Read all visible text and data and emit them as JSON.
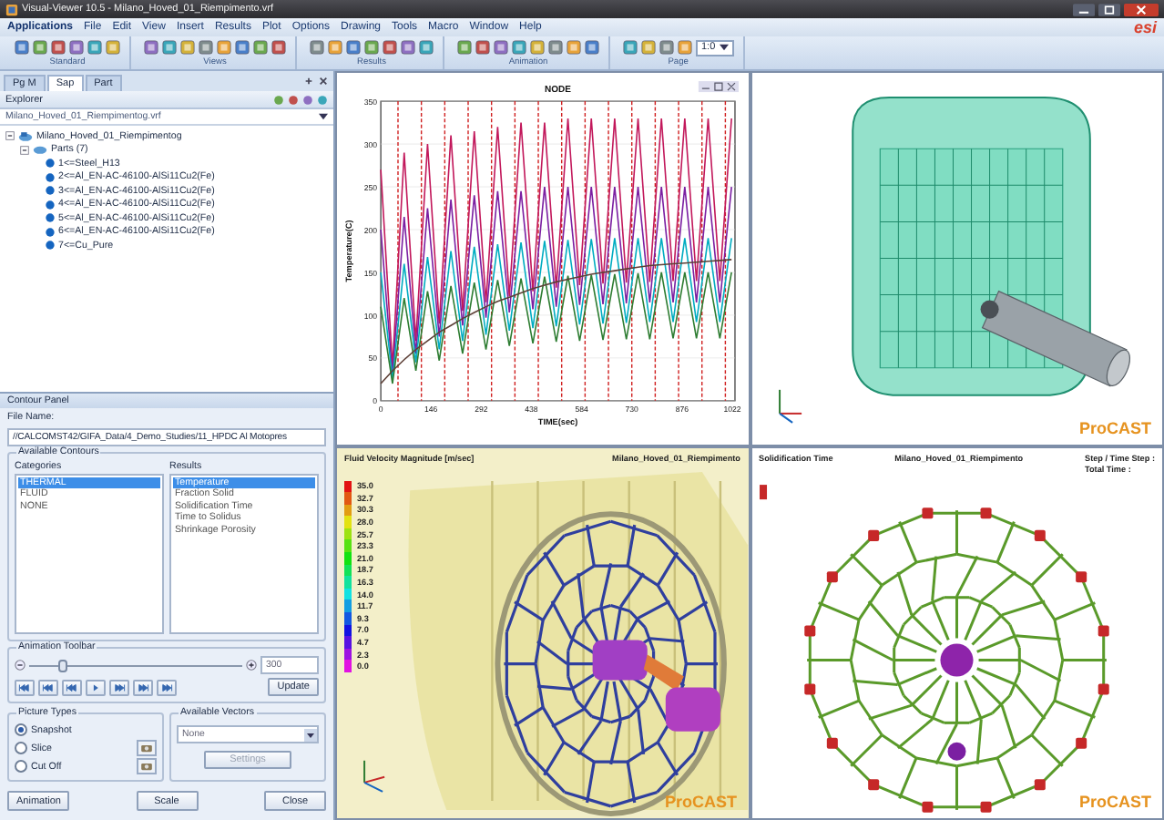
{
  "window": {
    "title": "Visual-Viewer 10.5 - Milano_Hoved_01_Riempimento.vrf",
    "logo": "esi"
  },
  "menu": {
    "app_button": "Applications",
    "items": [
      "File",
      "Edit",
      "View",
      "Insert",
      "Results",
      "Plot",
      "Options",
      "Drawing",
      "Tools",
      "Macro",
      "Window",
      "Help"
    ]
  },
  "ribbon": {
    "groups": [
      "Standard",
      "Views",
      "Results",
      "Animation",
      "Page"
    ],
    "page_zoom": "1:0"
  },
  "explorer": {
    "tabs": [
      {
        "label": "Pg M",
        "selected": false
      },
      {
        "label": "Sap",
        "selected": true
      },
      {
        "label": "Part",
        "selected": false
      }
    ],
    "title": "Explorer",
    "file": "Milano_Hoved_01_Riempimentog.vrf",
    "tree": [
      {
        "label": "Milano_Hoved_01_Riempimentog",
        "expanded": true,
        "children": [
          {
            "label": "Parts (7)",
            "expanded": true,
            "children": [
              {
                "label": "1<=Steel_H13"
              },
              {
                "label": "2<=Al_EN-AC-46100-AlSi11Cu2(Fe)"
              },
              {
                "label": "3<=Al_EN-AC-46100-AlSi11Cu2(Fe)"
              },
              {
                "label": "4<=Al_EN-AC-46100-AlSi11Cu2(Fe)"
              },
              {
                "label": "5<=Al_EN-AC-46100-AlSi11Cu2(Fe)"
              },
              {
                "label": "6<=Al_EN-AC-46100-AlSi11Cu2(Fe)"
              },
              {
                "label": "7<=Cu_Pure"
              }
            ]
          }
        ]
      }
    ]
  },
  "contour_panel": {
    "title": "Contour Panel",
    "file_label": "File Name:",
    "file_path": "//CALCOMST42/GIFA_Data/4_Demo_Studies/11_HPDC Al Motopres",
    "contours_label": "Available Contours",
    "categories_label": "Categories",
    "results_label": "Results",
    "categories": [
      {
        "label": "THERMAL",
        "selected": true
      },
      {
        "label": "FLUID",
        "selected": false
      },
      {
        "label": "NONE",
        "selected": false
      }
    ],
    "results": [
      {
        "label": "Temperature",
        "selected": true
      },
      {
        "label": "Fraction Solid",
        "selected": false
      },
      {
        "label": "Solidification Time",
        "selected": false
      },
      {
        "label": "Time to Solidus",
        "selected": false
      },
      {
        "label": "Shrinkage Porosity",
        "selected": false
      }
    ],
    "animation_label": "Animation Toolbar",
    "slider": {
      "level": 0.15
    },
    "frame": "300",
    "update": "Update",
    "picture_types_label": "Picture Types",
    "picture_types": [
      {
        "label": "Snapshot",
        "selected": true
      },
      {
        "label": "Slice",
        "selected": false
      },
      {
        "label": "Cut Off",
        "selected": false
      }
    ],
    "vectors_label": "Available Vectors",
    "vector": "None",
    "settings": {
      "label": "Settings",
      "disabled": true
    },
    "buttons": [
      "Animation",
      "Scale",
      "Close"
    ]
  },
  "viewports": [
    {
      "kind": "plot",
      "chart_data": {
        "type": "line",
        "title": "NODE",
        "xlabel": "TIME(sec)",
        "ylabel": "Temperature(C)",
        "x": [
          0,
          34,
          68,
          102,
          136,
          170,
          204,
          238,
          272,
          306,
          340,
          374,
          408,
          442,
          476,
          510,
          544,
          578,
          612,
          646,
          680,
          714,
          748,
          782,
          816,
          850,
          884,
          918,
          952,
          986,
          1020
        ],
        "series": [
          {
            "color": "#c2185b",
            "values": [
              270,
              40,
              290,
              70,
              300,
              90,
              310,
              105,
              315,
              115,
              320,
              122,
              325,
              128,
              325,
              132,
              330,
              135,
              330,
              137,
              330,
              138,
              330,
              139,
              330,
              140,
              330,
              140,
              330,
              140,
              330
            ]
          },
          {
            "color": "#7b1fa2",
            "values": [
              200,
              30,
              215,
              55,
              225,
              75,
              235,
              88,
              240,
              97,
              245,
              103,
              245,
              107,
              250,
              110,
              250,
              112,
              250,
              113,
              250,
              114,
              250,
              115,
              250,
              115,
              250,
              115,
              250,
              115,
              250
            ]
          },
          {
            "color": "#00acc1",
            "values": [
              150,
              25,
              160,
              45,
              168,
              60,
              175,
              70,
              180,
              77,
              183,
              82,
              185,
              85,
              187,
              87,
              188,
              89,
              189,
              90,
              190,
              91,
              190,
              92,
              190,
              92,
              190,
              92,
              190,
              92,
              190
            ]
          },
          {
            "color": "#2e7d32",
            "values": [
              110,
              20,
              120,
              35,
              128,
              47,
              134,
              55,
              138,
              60,
              141,
              64,
              143,
              67,
              145,
              69,
              146,
              70,
              147,
              71,
              148,
              72,
              149,
              72,
              150,
              73,
              150,
              73,
              150,
              73,
              150
            ]
          },
          {
            "color": "#5d4037",
            "values": [
              20,
              35,
              48,
              60,
              70,
              80,
              88,
              96,
              103,
              110,
              116,
              121,
              126,
              131,
              135,
              139,
              142,
              145,
              148,
              150,
              152,
              154,
              156,
              158,
              159,
              160,
              161,
              162,
              163,
              164,
              165
            ]
          }
        ],
        "ref_lines": [
          {
            "axis": "x",
            "value": 50,
            "color": "#d02020"
          },
          {
            "axis": "x",
            "value": 118,
            "color": "#d02020"
          },
          {
            "axis": "x",
            "value": 186,
            "color": "#d02020"
          },
          {
            "axis": "x",
            "value": 254,
            "color": "#d02020"
          },
          {
            "axis": "x",
            "value": 322,
            "color": "#d02020"
          },
          {
            "axis": "x",
            "value": 390,
            "color": "#d02020"
          },
          {
            "axis": "x",
            "value": 458,
            "color": "#d02020"
          },
          {
            "axis": "x",
            "value": 526,
            "color": "#d02020"
          },
          {
            "axis": "x",
            "value": 594,
            "color": "#d02020"
          },
          {
            "axis": "x",
            "value": 662,
            "color": "#d02020"
          },
          {
            "axis": "x",
            "value": 730,
            "color": "#d02020"
          },
          {
            "axis": "x",
            "value": 798,
            "color": "#d02020"
          },
          {
            "axis": "x",
            "value": 866,
            "color": "#d02020"
          },
          {
            "axis": "x",
            "value": 934,
            "color": "#d02020"
          },
          {
            "axis": "x",
            "value": 1002,
            "color": "#d02020"
          }
        ],
        "grid": true,
        "xlim": [
          0,
          1030
        ],
        "ylim": [
          0,
          350
        ],
        "xticks": [
          0,
          146,
          292,
          438,
          584,
          730,
          876,
          1022
        ],
        "yticks": [
          0,
          50,
          100,
          150,
          200,
          250,
          300,
          350
        ]
      }
    },
    {
      "kind": "casting",
      "brand": "ProCAST"
    },
    {
      "kind": "velocity",
      "title": "Fluid Velocity Magnitude [m/sec]",
      "model": "Milano_Hoved_01_Riempimento",
      "legend": [
        "35.0",
        "32.7",
        "30.3",
        "28.0",
        "25.7",
        "23.3",
        "21.0",
        "18.7",
        "16.3",
        "14.0",
        "11.7",
        "9.3",
        "7.0",
        "4.7",
        "2.3",
        "0.0"
      ],
      "brand": "ProCAST"
    },
    {
      "kind": "solidification",
      "title": "Solidification Time",
      "model": "Milano_Hoved_01_Riempimento",
      "step_label": "Step / Time Step :",
      "time_label": "Total Time :",
      "brand": "ProCAST"
    }
  ]
}
